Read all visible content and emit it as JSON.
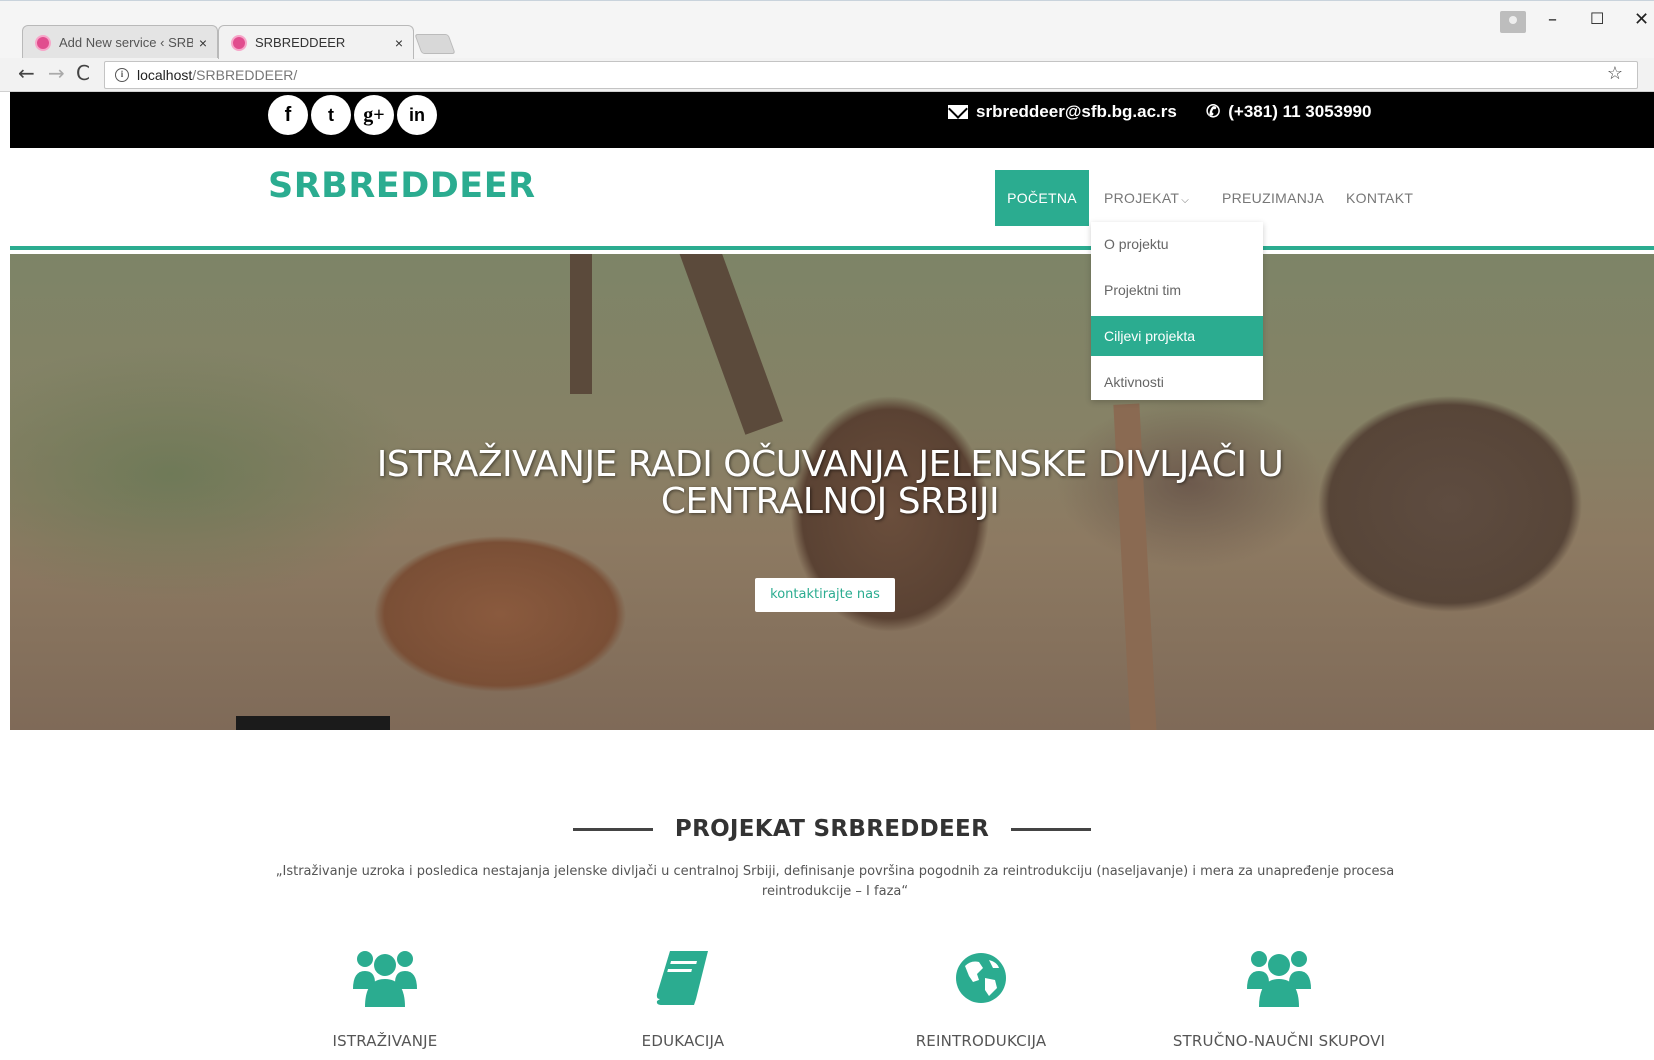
{
  "browser": {
    "tabs": [
      {
        "label": "Add New service ‹ SRBREDDEER",
        "close": "×"
      },
      {
        "label": "SRBREDDEER",
        "close": "×"
      }
    ],
    "window_controls": {
      "minimize": "–",
      "maximize": "☐",
      "close": "✕"
    },
    "nav": {
      "back": "←",
      "forward": "→",
      "reload": "C"
    },
    "url": {
      "host": "localhost",
      "path": "/SRBREDDEER/"
    }
  },
  "topbar": {
    "social": [
      {
        "name": "facebook",
        "glyph": "f"
      },
      {
        "name": "twitter",
        "glyph": "t"
      },
      {
        "name": "googleplus",
        "glyph": "g+"
      },
      {
        "name": "linkedin",
        "glyph": "in"
      }
    ],
    "email": "srbreddeer@sfb.bg.ac.rs",
    "phone": "(+381) 11 3053990"
  },
  "header": {
    "logo": "SRBREDDEER",
    "nav": [
      {
        "label": "POČETNA",
        "active": true
      },
      {
        "label": "PROJEKAT",
        "has_dropdown": true
      },
      {
        "label": "PREUZIMANJA"
      },
      {
        "label": "KONTAKT"
      }
    ]
  },
  "dropdown": {
    "items": [
      {
        "label": "O projektu"
      },
      {
        "label": "Projektni tim"
      },
      {
        "label": "Ciljevi projekta",
        "highlighted": true
      },
      {
        "label": "Aktivnosti"
      }
    ]
  },
  "hero": {
    "title_line1": "ISTRAŽIVANJE RADI OČUVANJA JELENSKE DIVLJAČI U",
    "title_line2": "CENTRALNOJ SRBIJI",
    "button": "kontaktirajte nas"
  },
  "project": {
    "heading": "PROJEKAT SRBREDDEER",
    "text": "„Istraživanje uzroka i posledica nestajanja jelenske divljači u centralnoj Srbiji, definisanje površina pogodnih za reintrodukciju (naseljavanje) i mera za unapređenje procesa reintrodukcije – I faza“"
  },
  "features": [
    {
      "label": "ISTRAŽIVANJE",
      "icon": "users-icon"
    },
    {
      "label": "EDUKACIJA",
      "icon": "book-icon"
    },
    {
      "label": "REINTRODUKCIJA",
      "icon": "globe-icon"
    },
    {
      "label": "STRUČNO-NAUČNI SKUPOVI",
      "icon": "users-icon"
    }
  ],
  "colors": {
    "accent": "#2bac90",
    "topbar": "#000000",
    "text": "#555555"
  }
}
